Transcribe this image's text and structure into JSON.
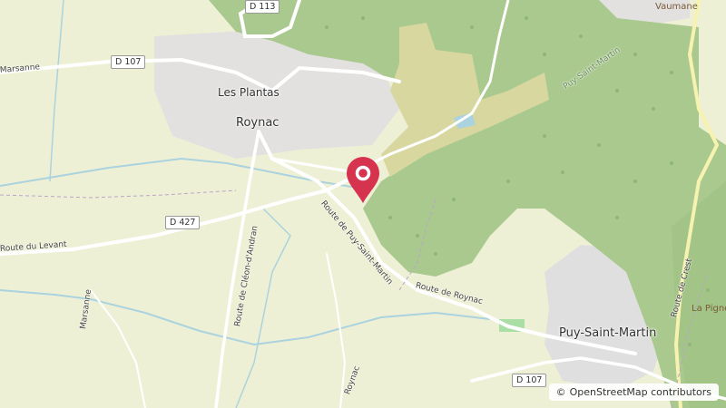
{
  "map": {
    "places": {
      "les_plantas": "Les Plantas",
      "roynac_town": "Roynac",
      "puy_saint_martin": "Puy-Saint-Martin",
      "vaumane": "Vaumane",
      "la_pigne": "La Pigne"
    },
    "roads": {
      "d113": "D 113",
      "d107_top": "D 107",
      "d427": "D 427",
      "d107_bottom": "D 107",
      "marsanne_road": "Marsanne",
      "route_levant": "Route du Levant",
      "route_clean": "Route de Cléon-d'Andran",
      "route_puy": "Route de Puy-Saint-Martin",
      "route_roynac": "Route de Roynac",
      "roynac_road": "Roynac",
      "marsanne_vert": "Marsanne",
      "route_crest": "Route de Crest",
      "puy_forest": "Puy Saint-Martin"
    },
    "marker": {
      "icon": "map-pin-icon",
      "color": "#d6334f"
    }
  },
  "attribution": {
    "symbol": "©",
    "text": "OpenStreetMap contributors"
  },
  "colors": {
    "farmland": "#eef0d5",
    "forest": "#aacb8f",
    "urban": "#e0dfdf",
    "water": "#aad3df"
  }
}
